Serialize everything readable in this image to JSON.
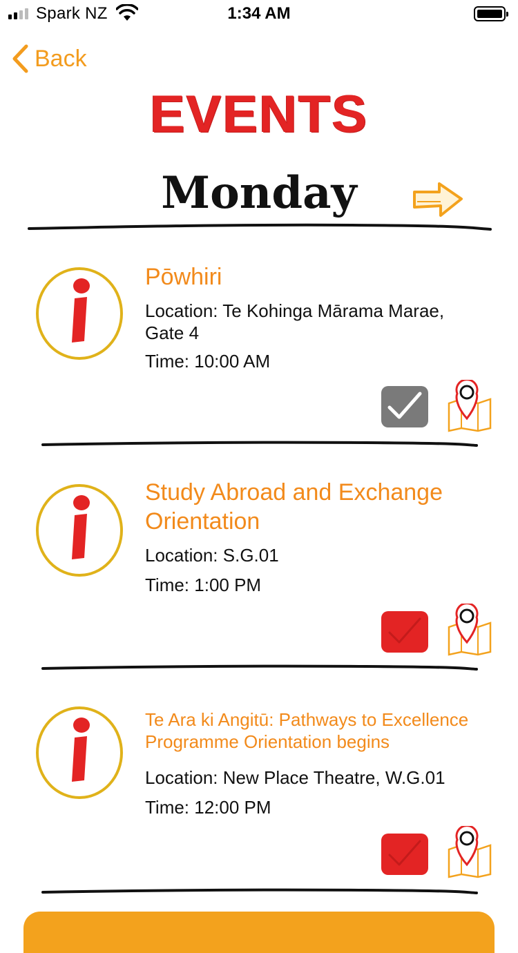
{
  "status_bar": {
    "carrier": "Spark NZ",
    "time": "1:34 AM"
  },
  "nav": {
    "back_label": "Back"
  },
  "header": {
    "title": "EVENTS",
    "day": "Monday"
  },
  "events": [
    {
      "title": "Pōwhiri",
      "location": "Location: Te Kohinga Mārama Marae,",
      "location_2": "Gate 4",
      "time": "Time: 10:00 AM",
      "checked": true
    },
    {
      "title": "Study Abroad and Exchange",
      "title_2": "Orientation",
      "location": "Location: S.G.01",
      "time": "Time: 1:00 PM",
      "checked": false
    },
    {
      "title": "Te Ara ki Angitū: Pathways to Excellence",
      "title_2": "Programme Orientation begins",
      "location": "Location: New Place Theatre, W.G.01",
      "time": "Time: 12:00 PM",
      "checked": false
    }
  ],
  "colors": {
    "accent_orange": "#f28a1b",
    "title_red": "#e32424",
    "info_ring": "#e0b21a",
    "checked_grey": "#7a7a7a",
    "unchecked_red": "#e32424"
  },
  "icons": {
    "info": "info-icon",
    "check": "checkbox-icon",
    "map": "map-pin-icon",
    "next": "right-arrow-icon"
  }
}
